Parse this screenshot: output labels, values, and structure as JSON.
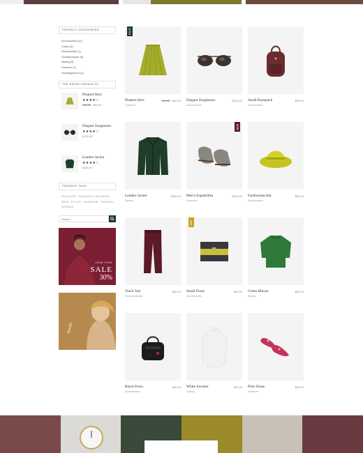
{
  "sidebar": {
    "categories_title": "Product Categories",
    "categories": [
      "Accessories (12)",
      "Coats (4)",
      "Gold jewelry (1)",
      "Occasionwear (6)",
      "Spring (9)",
      "Summer (7)",
      "Uncategorized (2)"
    ],
    "top_rated_title": "Top Rated Products",
    "top_rated": [
      {
        "name": "Pleated Skirt",
        "old_price": "$66.00",
        "price": "$60.00",
        "rating": 4
      },
      {
        "name": "Elegant Sunglasses",
        "old_price": "",
        "price": "$120.00",
        "rating": 4
      },
      {
        "name": "Leather Jacket",
        "old_price": "",
        "price": "$230.00",
        "rating": 4
      }
    ],
    "tags_title": "Product Tags",
    "tags": "Elegant, Fashion, Modern, New, Style, Sunrise, Trendy, Woman",
    "search_placeholder": "Search",
    "banner1": {
      "line1": "Grab Your",
      "line2": "SALE",
      "line3": "30%"
    },
    "banner2": {
      "script": "Amelle"
    }
  },
  "products": [
    {
      "name": "Pleated Skirt",
      "category": "Summer",
      "old_price": "$66.00",
      "price": "$60.00",
      "badge": "SALE"
    },
    {
      "name": "Elegant Sunglasses",
      "category": "Accessories",
      "old_price": "",
      "price": "$120.00",
      "badge": ""
    },
    {
      "name": "Small Backpack",
      "category": "Accessories",
      "old_price": "",
      "price": "$90.00",
      "badge": ""
    },
    {
      "name": "Leather Jacket",
      "category": "Spring",
      "old_price": "",
      "price": "$230.00",
      "badge": ""
    },
    {
      "name": "Men's Espadrilles",
      "category": "Summer",
      "old_price": "",
      "price": "$100.00",
      "badge": "NEW"
    },
    {
      "name": "Fashionista Hat",
      "category": "Accessories",
      "old_price": "",
      "price": "$50.00",
      "badge": ""
    },
    {
      "name": "Track Suit",
      "category": "Occasionwear",
      "old_price": "",
      "price": "$80.00",
      "badge": ""
    },
    {
      "name": "Small Purse",
      "category": "Accessories",
      "old_price": "",
      "price": "$90.00",
      "badge": "HOT"
    },
    {
      "name": "Green Blouse",
      "category": "Spring",
      "old_price": "",
      "price": "$90.00",
      "badge": ""
    },
    {
      "name": "Black Purse",
      "category": "Accessories",
      "old_price": "",
      "price": "$80.00",
      "badge": ""
    },
    {
      "name": "White Sweater",
      "category": "Spring",
      "old_price": "",
      "price": "$90.00",
      "badge": ""
    },
    {
      "name": "Pink Shoes",
      "category": "Summer",
      "old_price": "",
      "price": "$90.00",
      "badge": ""
    }
  ],
  "colors": {
    "accent": "#1e3a25",
    "badge_sale": "#1e3a25",
    "badge_new": "#5a1a2e",
    "badge_hot": "#c9a227"
  },
  "icons": [
    "search-icon",
    "star-icon"
  ]
}
